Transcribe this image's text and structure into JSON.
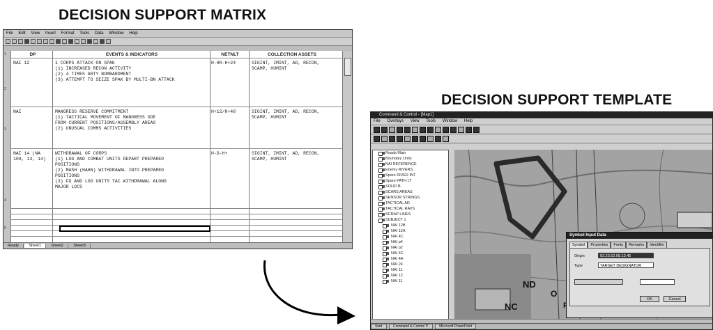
{
  "titles": {
    "matrix": "DECISION SUPPORT MATRIX",
    "template": "DECISION SUPPORT TEMPLATE"
  },
  "spreadsheet": {
    "menu": [
      "File",
      "Edit",
      "View",
      "Insert",
      "Format",
      "Tools",
      "Data",
      "Window",
      "Help"
    ],
    "headers": [
      "DP",
      "EVENTS & INDICATORS",
      "NETNLT",
      "COLLECTION ASSETS"
    ],
    "rows": [
      {
        "dp": "NAI 12",
        "events": [
          "1 CORPS ATTACK ON SPAK",
          "(1) INCREASED RECON ACTIVITY",
          "(2) 4 TIMES ARTY BOMBARDMENT",
          "(3) ATTEMPT TO SEIZE SPAK BY MULTI-BN ATTACK"
        ],
        "netnlt": "H-HR-H+24",
        "assets": [
          "SIGINT, IMINT, AD, RECON,",
          "SCAMP, HUMINT"
        ]
      },
      {
        "dp": "NAI",
        "events": [
          "MANGRESS RESERVE COMMITMENT",
          "(1) TACTICAL MOVEMENT OF MANGRESS SDE",
          "FROM CURRENT POSITIONS/ASSEMBLY AREAS",
          "(2) UNUSUAL COMMS ACTIVITIES"
        ],
        "netnlt": "H+12/H+48",
        "assets": [
          "SIGINT, IMINT, AD, RECON,",
          "SCAMP, HUMINT"
        ]
      },
      {
        "dp": "NAI 14 (NA",
        "dp2": "108, 13, 14)",
        "events": [
          "WITHDRAWAL OF CORPS",
          "(1) LOG AND COMBAT UNITS DEPART PREPARED",
          "POSITIONS",
          "(2) MASH (HAHN) WITHDRAWAL INTO PREPARED",
          "POSITIONS",
          "(3) FO AND LOG UNITS TAC WITHDRAWAL ALONG",
          "MAJOR LOCS"
        ],
        "netnlt": "H-D-H+",
        "assets": [
          "SIGINT, IMINT, AD, RECON,",
          "SCAMP, HUMINT"
        ]
      }
    ],
    "row_numbers": [
      "1",
      "2",
      "3",
      "4",
      "5",
      "6",
      "7",
      "8",
      "9",
      "10",
      "11",
      "12",
      "13",
      "14",
      "15",
      "16",
      "17",
      "18",
      "19",
      "20"
    ],
    "sheet_tabs": [
      "Sheet1",
      "Sheet2",
      "Sheet3"
    ],
    "status": "Ready"
  },
  "map_app": {
    "window_title": "Command & Control - [Map1]",
    "menu": [
      "File",
      "Overlays",
      "View",
      "Tools",
      "Window",
      "Help"
    ],
    "layers": [
      "Roads Main",
      "Boundary Units",
      "NAI REFERENCE",
      "Enemy RIVERS",
      "Spare RIVER INT",
      "Spare PATH LT",
      "SOLID B",
      "SCARS AREAS",
      "SENSOR STRINGS",
      "TACTICAL AD",
      "TACTICAL RAVS",
      "SCRAP LINES",
      "SUBJECT 1"
    ],
    "sub_layers": [
      "NAI 12B",
      "NAI 12A",
      "NAI 4C",
      "NAI p4",
      "NAI p2",
      "NAI 4C",
      "NAI 4A",
      "NAI 24",
      "NAI 11",
      "NAI 12",
      "NAI 11"
    ],
    "map_labels": [
      "ND",
      "NC",
      "FD",
      "FC",
      "O"
    ],
    "dialog": {
      "title": "Symbol Input Data",
      "tabs": [
        "Symbol",
        "Properties",
        "Fonts",
        "Remarks",
        "Identifier"
      ],
      "origin_label": "Origin",
      "origin_value": "03.23.52.08.13.45",
      "type_label": "Type",
      "type_value": "TARGET DESIGNATOR",
      "ok": "OK",
      "cancel": "Cancel"
    },
    "taskbar": [
      "Start",
      "Command & Control P.",
      "Microsoft PowerPoint"
    ]
  }
}
